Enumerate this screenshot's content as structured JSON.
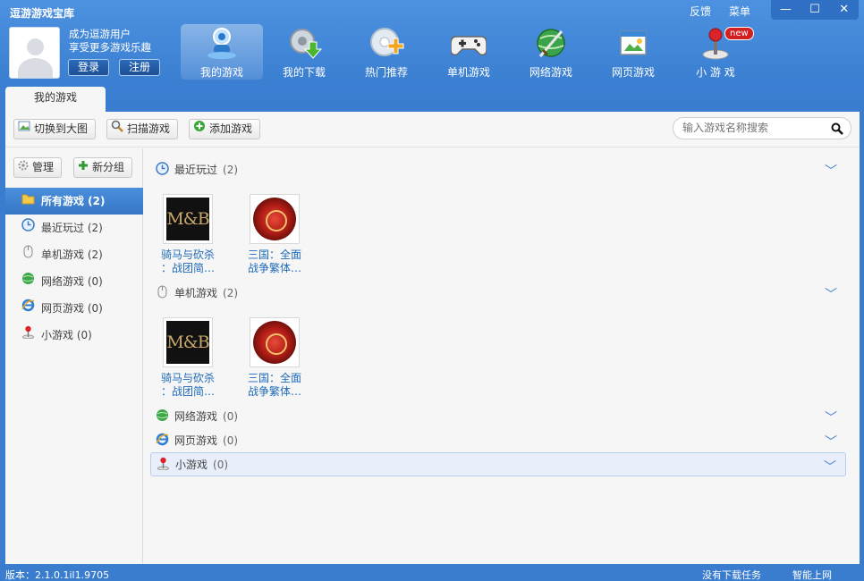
{
  "app": {
    "title": "逗游游戏宝库"
  },
  "top_links": {
    "feedback": "反馈",
    "menu": "菜单"
  },
  "window_controls": {
    "minimize": "—",
    "maximize": "☐",
    "close": "✕"
  },
  "user": {
    "line1": "成为逗游用户",
    "line2": "享受更多游戏乐趣",
    "login": "登录",
    "register": "注册"
  },
  "nav": {
    "items": [
      {
        "label": "我的游戏",
        "icon": "my-games-icon"
      },
      {
        "label": "我的下载",
        "icon": "download-gear-icon"
      },
      {
        "label": "热门推荐",
        "icon": "hot-disc-icon"
      },
      {
        "label": "单机游戏",
        "icon": "gamepad-icon"
      },
      {
        "label": "网络游戏",
        "icon": "globe-sword-icon"
      },
      {
        "label": "网页游戏",
        "icon": "web-page-icon"
      },
      {
        "label": "小 游 戏",
        "icon": "joystick-icon"
      }
    ],
    "new_badge": "new"
  },
  "tab": {
    "my_games": "我的游戏"
  },
  "toolbar": {
    "switch_view": "切换到大图",
    "scan": "扫描游戏",
    "add": "添加游戏",
    "search_placeholder": "输入游戏名称搜索"
  },
  "sidebar": {
    "manage": "管理",
    "new_group": "新分组",
    "items": [
      {
        "label": "所有游戏 (2)",
        "icon": "folder-icon"
      },
      {
        "label": "最近玩过 (2)",
        "icon": "clock-icon"
      },
      {
        "label": "单机游戏 (2)",
        "icon": "mouse-icon"
      },
      {
        "label": "网络游戏 (0)",
        "icon": "globe-icon"
      },
      {
        "label": "网页游戏 (0)",
        "icon": "ie-icon"
      },
      {
        "label": "小游戏 (0)",
        "icon": "joystick-icon"
      }
    ]
  },
  "sections": {
    "recent": {
      "title": "最近玩过",
      "count": "(2)"
    },
    "single": {
      "title": "单机游戏",
      "count": "(2)"
    },
    "online": {
      "title": "网络游戏",
      "count": "(0)"
    },
    "web": {
      "title": "网页游戏",
      "count": "(0)"
    },
    "mini": {
      "title": "小游戏",
      "count": "(0)"
    }
  },
  "games": {
    "mb": {
      "logo": "M&B",
      "name_line1": "骑马与砍杀",
      "name_line2": "：战团简…"
    },
    "sg": {
      "name_line1": "三国：全面",
      "name_line2": "战争繁体…"
    }
  },
  "status": {
    "version": "版本：2.1.0.1il1.9705",
    "right1": "没有下载任务",
    "right2": "智能上网"
  },
  "colors": {
    "header_blue": "#3b7fd2",
    "active_blue": "#3677c6",
    "link_blue": "#1e6ab8",
    "badge_red": "#d21f1f"
  }
}
